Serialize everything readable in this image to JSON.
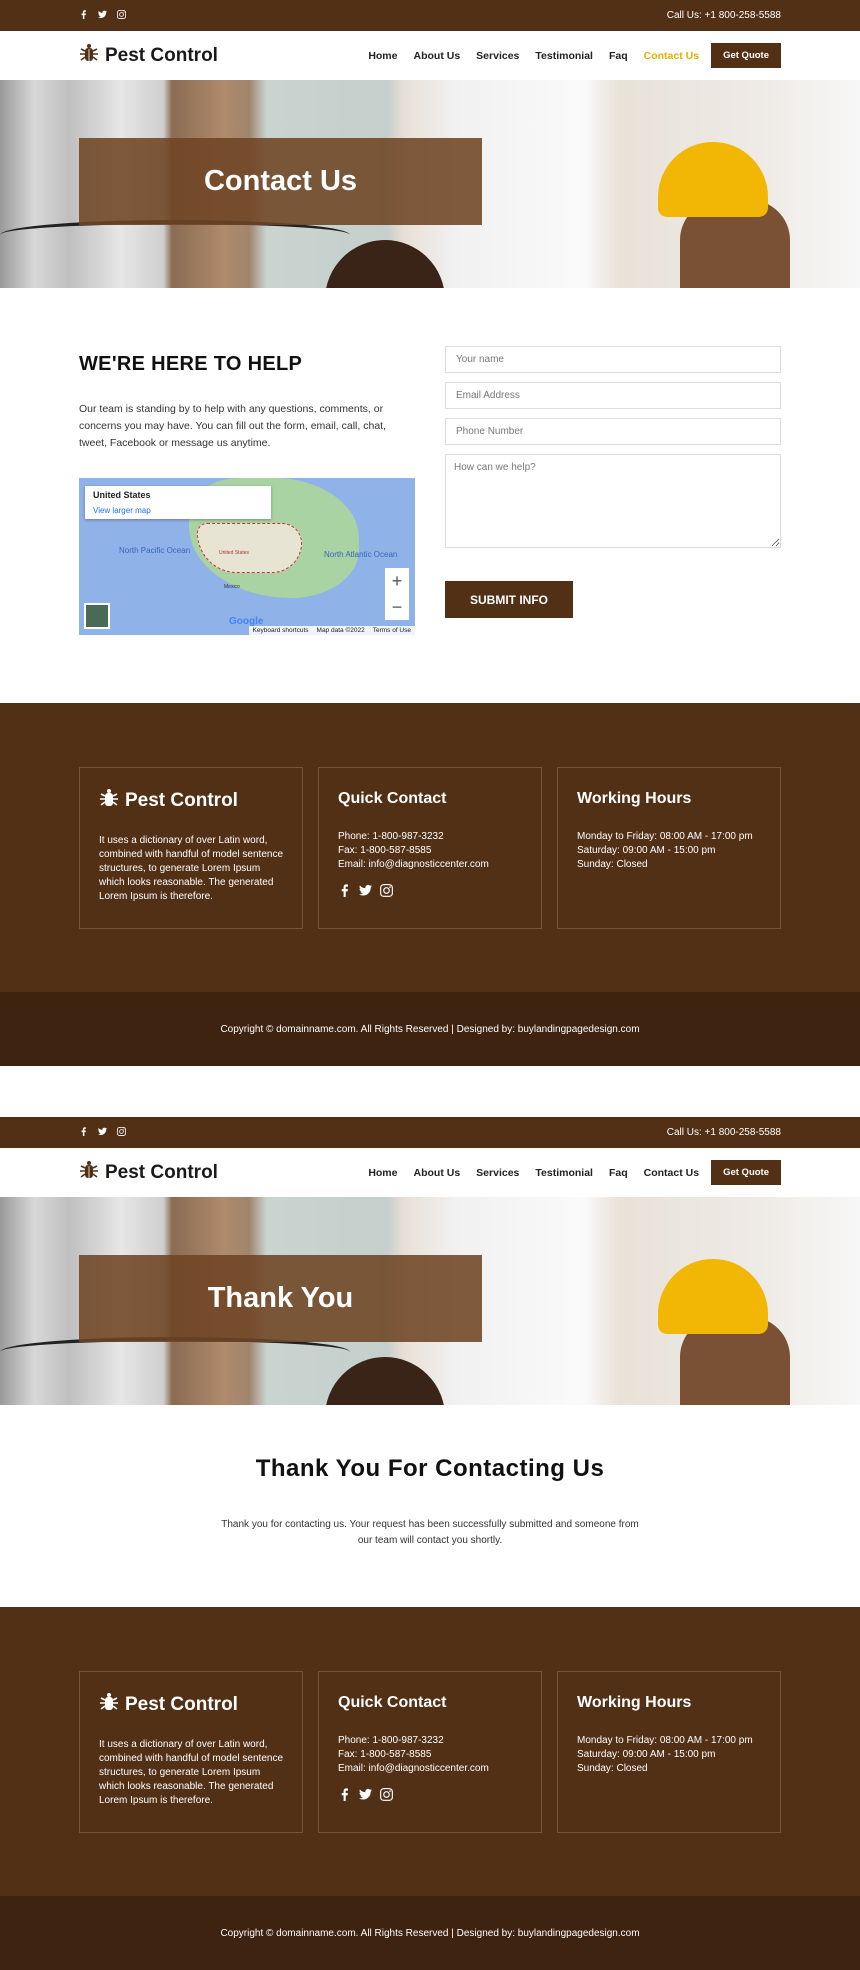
{
  "colors": {
    "brand": "#523016",
    "accent": "#e0b000",
    "copyright_bg": "#3d2310"
  },
  "pages": [
    {
      "topbar": {
        "social": [
          "facebook-icon",
          "twitter-icon",
          "instagram-icon"
        ],
        "phone": "Call Us: +1 800-258-5588"
      },
      "nav": {
        "logo": "Pest Control",
        "items": [
          "Home",
          "About Us",
          "Services",
          "Testimonial",
          "Faq",
          "Contact Us"
        ],
        "active": "Contact Us",
        "cta": "Get Quote"
      },
      "hero": {
        "title": "Contact Us"
      },
      "contact": {
        "heading": "WE'RE HERE TO HELP",
        "text": "Our team is standing by to help with any questions, comments, or concerns you may have. You can fill out the form, email, call, chat, tweet, Facebook or message us anytime.",
        "map": {
          "place": "United States",
          "link": "View larger map",
          "labels": [
            "North Pacific Ocean",
            "North Atlantic Ocean",
            "United States",
            "Mexico"
          ],
          "attribution": [
            "Keyboard shortcuts",
            "Map data ©2022",
            "Terms of Use"
          ],
          "provider": "Google"
        },
        "form": {
          "name_placeholder": "Your name",
          "email_placeholder": "Email Address",
          "phone_placeholder": "Phone Number",
          "message_placeholder": "How can we help?",
          "submit": "SUBMIT INFO"
        }
      }
    },
    {
      "topbar": {
        "social": [
          "facebook-icon",
          "twitter-icon",
          "instagram-icon"
        ],
        "phone": "Call Us: +1 800-258-5588"
      },
      "nav": {
        "logo": "Pest Control",
        "items": [
          "Home",
          "About Us",
          "Services",
          "Testimonial",
          "Faq",
          "Contact Us"
        ],
        "active": "",
        "cta": "Get Quote"
      },
      "hero": {
        "title": "Thank You"
      },
      "thanks": {
        "heading": "Thank You For Contacting Us",
        "text": "Thank you for contacting us. Your request has been successfully submitted and someone from our team will contact you shortly."
      }
    }
  ],
  "footer": {
    "about": {
      "logo": "Pest Control",
      "text": "It uses a dictionary of over Latin word, combined with handful of model sentence structures, to generate Lorem Ipsum which looks reasonable. The generated Lorem Ipsum is therefore."
    },
    "contact": {
      "title": "Quick Contact",
      "phone": "Phone: 1-800-987-3232",
      "fax": "Fax: 1-800-587-8585",
      "email": "Email: info@diagnosticcenter.com"
    },
    "hours": {
      "title": "Working Hours",
      "lines": [
        "Monday to Friday: 08:00 AM - 17:00 pm",
        "Saturday: 09:00 AM - 15:00 pm",
        "Sunday: Closed"
      ]
    },
    "copyright": "Copyright © domainname.com. All Rights Reserved | Designed by: buylandingpagedesign.com"
  }
}
